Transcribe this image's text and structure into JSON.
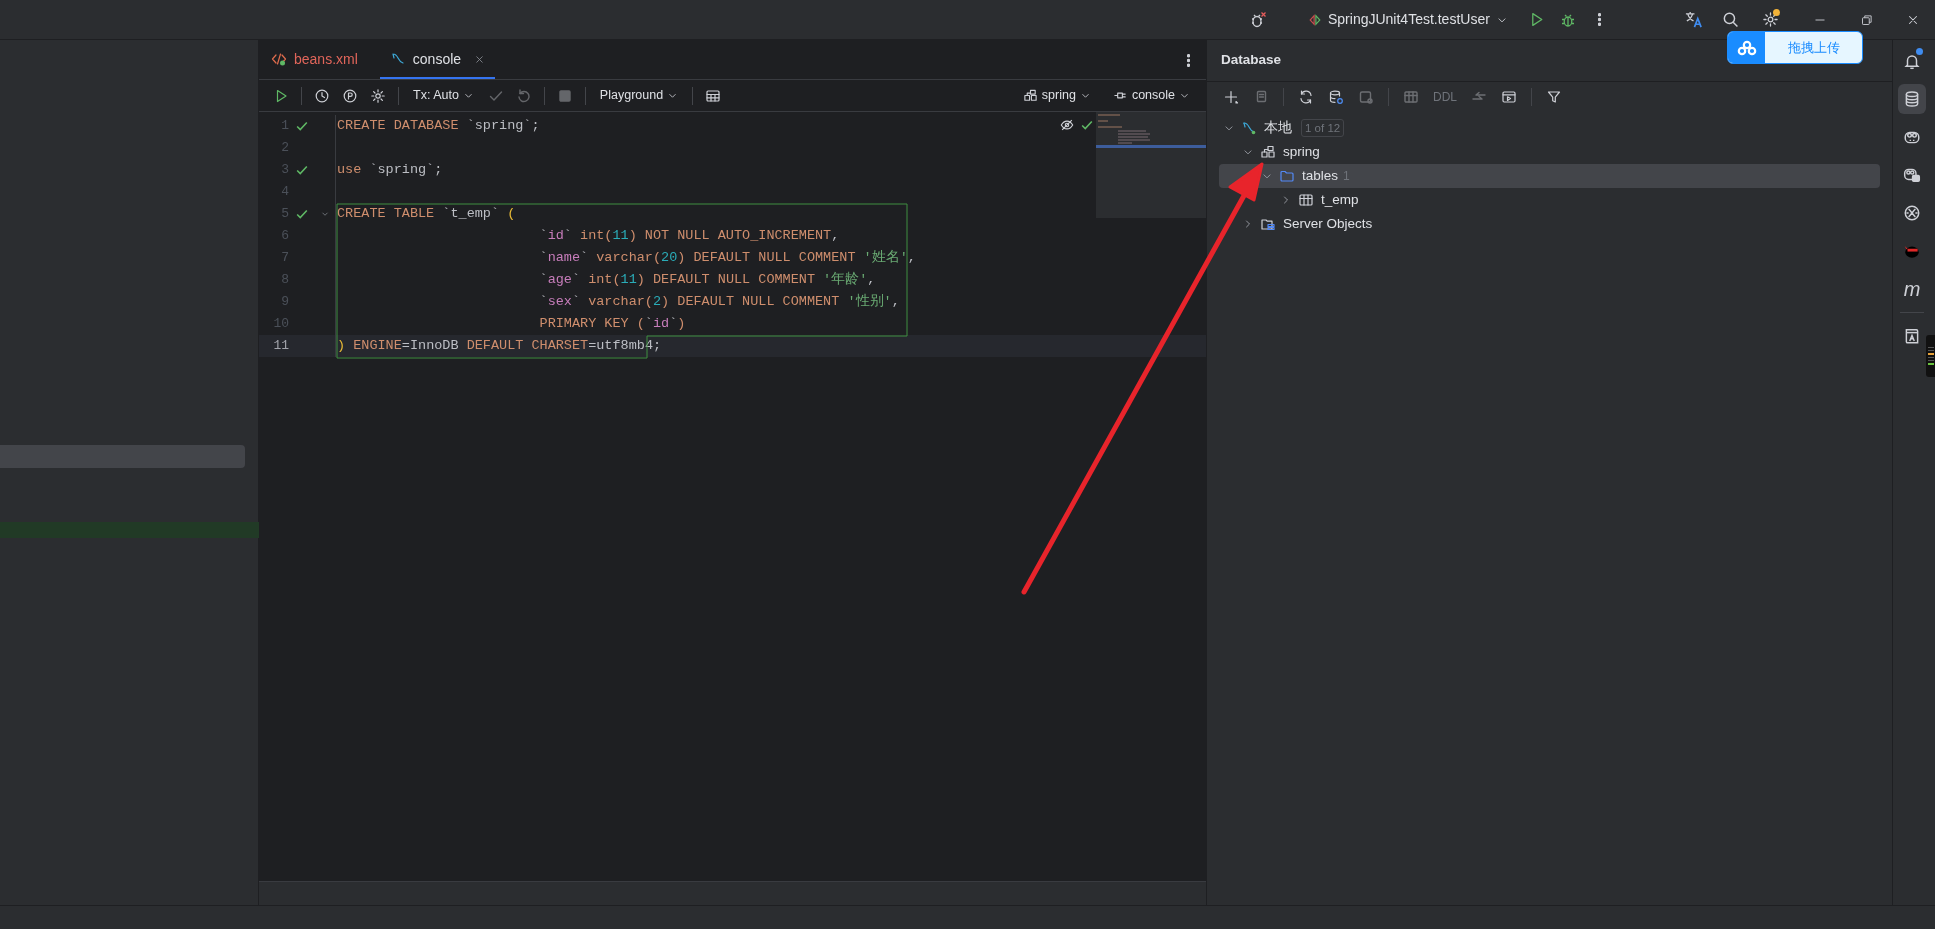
{
  "title_bar": {
    "run_configuration": "SpringJUnit4Test.testUser",
    "settings_update_badge": true,
    "upload_popup": {
      "label": "拖拽上传"
    }
  },
  "editor": {
    "tabs": [
      {
        "label": "beans.xml",
        "kind": "xml",
        "selected": false,
        "has_error": true
      },
      {
        "label": "console",
        "kind": "console",
        "selected": true,
        "has_error": false
      }
    ],
    "toolbar": [
      {
        "kind": "run",
        "disabled": false
      },
      {
        "kind": "sep"
      },
      {
        "kind": "history",
        "disabled": false
      },
      {
        "kind": "parameters",
        "disabled": false
      },
      {
        "kind": "settings",
        "disabled": false
      },
      {
        "kind": "sep"
      },
      {
        "kind": "dropdown",
        "label": "Tx: Auto"
      },
      {
        "kind": "commit",
        "disabled": true
      },
      {
        "kind": "rollback",
        "disabled": true
      },
      {
        "kind": "sep"
      },
      {
        "kind": "stop",
        "disabled": true
      },
      {
        "kind": "sep"
      },
      {
        "kind": "dropdown",
        "label": "Playground"
      },
      {
        "kind": "sep"
      },
      {
        "kind": "grid",
        "disabled": false
      }
    ],
    "schema": "spring",
    "session": "console",
    "lines": [
      {
        "number": "1",
        "executed": true,
        "foldable": false,
        "current": false,
        "tokens": [
          {
            "kind": "kw",
            "text": "CREATE DATABASE "
          },
          {
            "kind": "plain",
            "text": "`spring`;"
          }
        ]
      },
      {
        "number": "2",
        "executed": false,
        "foldable": false,
        "current": false
      },
      {
        "number": "3",
        "executed": true,
        "foldable": false,
        "current": false,
        "tokens": [
          {
            "kind": "kw",
            "text": "use "
          },
          {
            "kind": "plain",
            "text": "`spring`;"
          }
        ]
      },
      {
        "number": "4",
        "executed": false,
        "foldable": false,
        "current": false
      },
      {
        "number": "5",
        "executed": true,
        "foldable": true,
        "current": false,
        "tokens": [
          {
            "kind": "kw",
            "text": "CREATE TABLE "
          },
          {
            "kind": "plain",
            "text": "`t_emp` "
          },
          {
            "kind": "bracket",
            "text": "("
          }
        ]
      },
      {
        "number": "6",
        "executed": false,
        "foldable": false,
        "current": false,
        "tokens": [
          {
            "kind": "plain",
            "text": "                         `"
          },
          {
            "kind": "col",
            "text": "id"
          },
          {
            "kind": "plain",
            "text": "` "
          },
          {
            "kind": "kw",
            "text": "int("
          },
          {
            "kind": "num",
            "text": "11"
          },
          {
            "kind": "kw",
            "text": ") NOT NULL AUTO_INCREMENT"
          },
          {
            "kind": "plain",
            "text": ","
          }
        ]
      },
      {
        "number": "7",
        "executed": false,
        "foldable": false,
        "current": false,
        "tokens": [
          {
            "kind": "plain",
            "text": "                         `"
          },
          {
            "kind": "col",
            "text": "name"
          },
          {
            "kind": "plain",
            "text": "` "
          },
          {
            "kind": "kw",
            "text": "varchar("
          },
          {
            "kind": "num",
            "text": "20"
          },
          {
            "kind": "kw",
            "text": ") DEFAULT NULL COMMENT "
          },
          {
            "kind": "str",
            "text": "'姓名'"
          },
          {
            "kind": "plain",
            "text": ","
          }
        ]
      },
      {
        "number": "8",
        "executed": false,
        "foldable": false,
        "current": false,
        "tokens": [
          {
            "kind": "plain",
            "text": "                         `"
          },
          {
            "kind": "col",
            "text": "age"
          },
          {
            "kind": "plain",
            "text": "` "
          },
          {
            "kind": "kw",
            "text": "int("
          },
          {
            "kind": "num",
            "text": "11"
          },
          {
            "kind": "kw",
            "text": ") DEFAULT NULL COMMENT "
          },
          {
            "kind": "str",
            "text": "'年龄'"
          },
          {
            "kind": "plain",
            "text": ","
          }
        ]
      },
      {
        "number": "9",
        "executed": false,
        "foldable": false,
        "current": false,
        "tokens": [
          {
            "kind": "plain",
            "text": "                         `"
          },
          {
            "kind": "col",
            "text": "sex"
          },
          {
            "kind": "plain",
            "text": "` "
          },
          {
            "kind": "kw",
            "text": "varchar("
          },
          {
            "kind": "num",
            "text": "2"
          },
          {
            "kind": "kw",
            "text": ") DEFAULT NULL COMMENT "
          },
          {
            "kind": "str",
            "text": "'性别'"
          },
          {
            "kind": "plain",
            "text": ","
          }
        ]
      },
      {
        "number": "10",
        "executed": false,
        "foldable": false,
        "current": false,
        "tokens": [
          {
            "kind": "kw",
            "text": "                         PRIMARY KEY ("
          },
          {
            "kind": "plain",
            "text": "`"
          },
          {
            "kind": "col",
            "text": "id"
          },
          {
            "kind": "plain",
            "text": "`"
          },
          {
            "kind": "kw",
            "text": ")"
          }
        ]
      },
      {
        "number": "11",
        "executed": false,
        "foldable": false,
        "current": true,
        "tokens": [
          {
            "kind": "bracket",
            "text": ")"
          },
          {
            "kind": "kw",
            "text": " ENGINE"
          },
          {
            "kind": "plain",
            "text": "=InnoDB "
          },
          {
            "kind": "kw",
            "text": "DEFAULT CHARSET"
          },
          {
            "kind": "plain",
            "text": "=utf8mb4;"
          }
        ]
      }
    ]
  },
  "database": {
    "title": "Database",
    "toolbar": [
      {
        "kind": "add",
        "disabled": false
      },
      {
        "kind": "copy",
        "disabled": true
      },
      {
        "kind": "sep"
      },
      {
        "kind": "refresh",
        "disabled": false
      },
      {
        "kind": "db-settings",
        "disabled": false
      },
      {
        "kind": "jump",
        "disabled": true
      },
      {
        "kind": "sep"
      },
      {
        "kind": "table",
        "disabled": true
      },
      {
        "kind": "text",
        "label": "DDL",
        "disabled": true
      },
      {
        "kind": "compare",
        "disabled": true
      },
      {
        "kind": "console",
        "disabled": false
      },
      {
        "kind": "sep"
      },
      {
        "kind": "filter",
        "disabled": false
      }
    ],
    "tree": [
      {
        "label": "本地",
        "kind": "connection",
        "badge": "1 of 12",
        "expanded": true,
        "selected": false,
        "children": [
          {
            "label": "spring",
            "kind": "schema",
            "expanded": true,
            "selected": false,
            "children": [
              {
                "label": "tables",
                "kind": "folder",
                "count": "1",
                "expanded": true,
                "selected": true,
                "children": [
                  {
                    "label": "t_emp",
                    "kind": "table",
                    "expanded": false,
                    "selected": false
                  }
                ]
              }
            ]
          },
          {
            "label": "Server Objects",
            "kind": "server",
            "expanded": false,
            "selected": false
          }
        ]
      }
    ]
  },
  "right_toolbar": [
    {
      "kind": "notifications",
      "badge": true,
      "selected": false
    },
    {
      "kind": "database",
      "selected": true
    },
    {
      "kind": "assistant",
      "selected": false
    },
    {
      "kind": "assistant-chat",
      "selected": false
    },
    {
      "kind": "ai",
      "selected": false
    },
    {
      "kind": "ninja",
      "selected": false
    },
    {
      "kind": "letter",
      "label": "m",
      "selected": false
    },
    {
      "kind": "sep"
    },
    {
      "kind": "book",
      "selected": false
    }
  ],
  "annotations": [
    {
      "kind": "arrow"
    }
  ]
}
